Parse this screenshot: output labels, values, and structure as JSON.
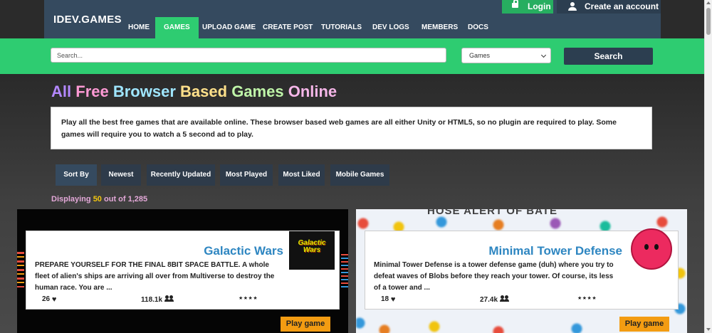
{
  "header": {
    "logo": "IDEV.GAMES",
    "nav": [
      {
        "label": "HOME"
      },
      {
        "label": "GAMES"
      },
      {
        "label": "UPLOAD GAME"
      },
      {
        "label": "CREATE POST"
      },
      {
        "label": "TUTORIALS"
      },
      {
        "label": "DEV LOGS"
      },
      {
        "label": "MEMBERS"
      },
      {
        "label": "DOCS"
      }
    ],
    "active_nav": "GAMES",
    "login_label": "Login",
    "create_account_label": "Create an account"
  },
  "search": {
    "placeholder": "Search...",
    "category_selected": "Games",
    "button_label": "Search"
  },
  "main": {
    "title_words": [
      "All",
      "Free",
      "Browser",
      "Based",
      "Games",
      "Online"
    ],
    "title_colors": [
      "#b388ff",
      "#ff9ad5",
      "#9fe6ff",
      "#ffe08a",
      "#bff5a8",
      "#f5b6e8"
    ],
    "intro": "Play all the best free games that are available online. These browser based web games are all either Unity or HTML5, so no plugin are required to play. Some games will require you to watch a 5 second ad to play.",
    "sort": {
      "label": "Sort By",
      "options": [
        "Newest",
        "Recently Updated",
        "Most Played",
        "Most Liked",
        "Mobile Games"
      ]
    },
    "displaying": {
      "prefix": "Displaying",
      "shown": "50",
      "middle": "out of",
      "total": "1,285"
    }
  },
  "games": [
    {
      "title": "Galactic Wars",
      "thumb_text": "Galactic Wars",
      "description": "PREPARE YOURSELF FOR THE FINAL 8BIT SPACE BATTLE. A whole fleet of alien's ships are arriving all over from Multiverse to destroy the human race. You are ...",
      "likes": "26",
      "plays": "118.1k",
      "rating": 4,
      "stars": "★★★★",
      "play_label": "Play game"
    },
    {
      "title": "Minimal Tower Defense",
      "banner_text": "HOSE ALERT OF BATE",
      "description": "Minimal Tower Defense is a tower defense game (duh) where you try to defeat waves of Blobs before they reach your tower. Of course, its less of a tower and ...",
      "likes": "18",
      "plays": "27.4k",
      "rating": 4,
      "stars": "★★★★",
      "play_label": "Play game"
    }
  ],
  "colors": {
    "header_bg": "#354a5f",
    "accent_green": "#2ecc71",
    "search_button": "#2c3e50",
    "play_button": "#f39c12",
    "card_title": "#2e86c1"
  }
}
